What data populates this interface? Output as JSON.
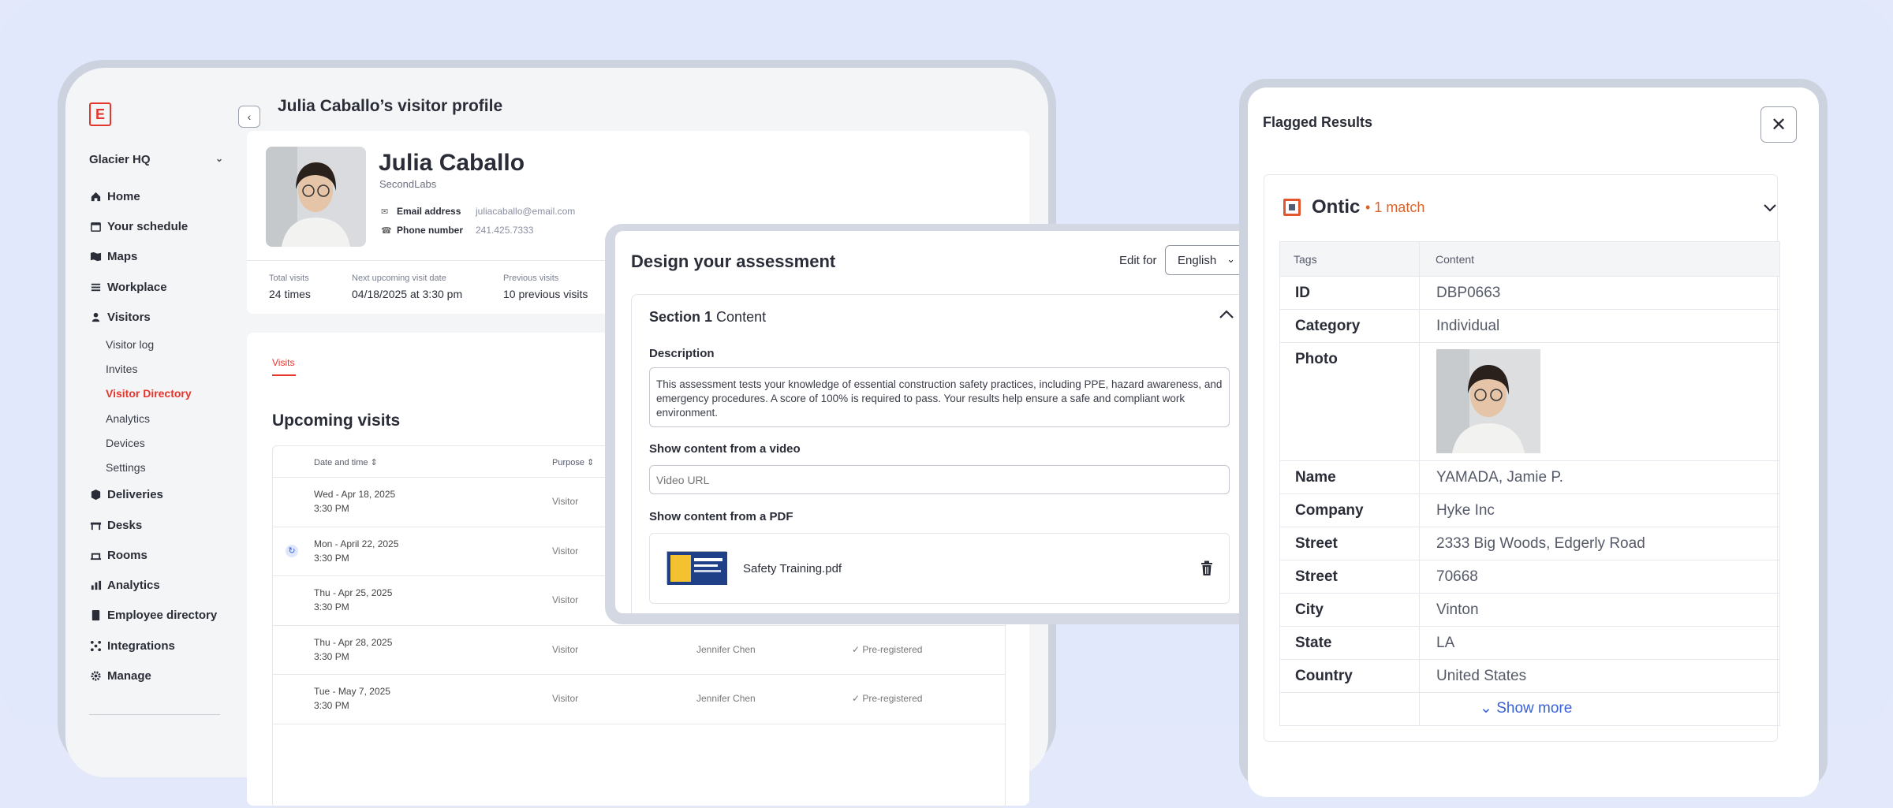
{
  "sidebar": {
    "location": "Glacier HQ",
    "nav_items": [
      {
        "label": "Home",
        "icon": "home-icon"
      },
      {
        "label": "Your schedule",
        "icon": "calendar-icon"
      },
      {
        "label": "Maps",
        "icon": "map-icon"
      },
      {
        "label": "Workplace",
        "icon": "list-icon"
      },
      {
        "label": "Visitors",
        "icon": "person-icon"
      }
    ],
    "visitor_subitems": [
      "Visitor log",
      "Invites",
      "Visitor Directory",
      "Analytics",
      "Devices",
      "Settings"
    ],
    "active_subitem": "Visitor Directory",
    "nav_items_after": [
      {
        "label": "Deliveries",
        "icon": "box-icon"
      },
      {
        "label": "Desks",
        "icon": "desk-icon"
      },
      {
        "label": "Rooms",
        "icon": "rooms-icon"
      },
      {
        "label": "Analytics",
        "icon": "chart-icon"
      },
      {
        "label": "Employee directory",
        "icon": "book-icon"
      },
      {
        "label": "Integrations",
        "icon": "integrations-icon"
      },
      {
        "label": "Manage",
        "icon": "gear-icon"
      }
    ]
  },
  "profile": {
    "page_title": "Julia Caballo’s visitor profile",
    "name": "Julia Caballo",
    "company": "SecondLabs",
    "email_label": "Email address",
    "email": "juliacaballo@email.com",
    "phone_label": "Phone number",
    "phone": "241.425.7333",
    "stats": [
      {
        "label": "Total visits",
        "value": "24 times"
      },
      {
        "label": "Next upcoming visit date",
        "value": "04/18/2025 at 3:30 pm"
      },
      {
        "label": "Previous visits",
        "value": "10 previous visits"
      }
    ]
  },
  "visits": {
    "tab": "Visits",
    "heading": "Upcoming visits",
    "columns": {
      "date": "Date and time",
      "purpose": "Purpose"
    },
    "rows": [
      {
        "date": "Wed - Apr 18, 2025",
        "time": "3:30 PM",
        "purpose": "Visitor",
        "host": "",
        "status": "",
        "sync": false
      },
      {
        "date": "Mon - April 22, 2025",
        "time": "3:30 PM",
        "purpose": "Visitor",
        "host": "",
        "status": "",
        "sync": true
      },
      {
        "date": "Thu - Apr 25, 2025",
        "time": "3:30 PM",
        "purpose": "Visitor",
        "host": "",
        "status": "",
        "sync": false
      },
      {
        "date": "Thu - Apr 28, 2025",
        "time": "3:30 PM",
        "purpose": "Visitor",
        "host": "Jennifer Chen",
        "status": "Pre-registered",
        "sync": false
      },
      {
        "date": "Tue - May 7, 2025",
        "time": "3:30 PM",
        "purpose": "Visitor",
        "host": "Jennifer Chen",
        "status": "Pre-registered",
        "sync": false
      }
    ]
  },
  "assessment": {
    "title": "Design your assessment",
    "edit_for": "Edit for",
    "language": "English",
    "section_number": "Section 1",
    "section_name": "Content",
    "description_label": "Description",
    "description": "This assessment tests your knowledge of essential construction safety practices, including PPE, hazard awareness, and emergency procedures. A score of 100% is required to pass. Your results help ensure a safe and compliant work environment.",
    "video_label": "Show content from a video",
    "video_placeholder": "Video URL",
    "pdf_label": "Show content from a PDF",
    "pdf_file": "Safety Training.pdf"
  },
  "flagged": {
    "title": "Flagged Results",
    "source": "Ontic",
    "match": "• 1 match",
    "col_tags": "Tags",
    "col_content": "Content",
    "rows": [
      {
        "tag": "ID",
        "value": "DBP0663"
      },
      {
        "tag": "Category",
        "value": "Individual"
      },
      {
        "tag": "Photo",
        "value": ""
      },
      {
        "tag": "Name",
        "value": "YAMADA, Jamie P."
      },
      {
        "tag": "Company",
        "value": "Hyke Inc"
      },
      {
        "tag": "Street",
        "value": "2333 Big Woods, Edgerly Road"
      },
      {
        "tag": "Street",
        "value": "70668"
      },
      {
        "tag": "City",
        "value": "Vinton"
      },
      {
        "tag": "State",
        "value": "LA"
      },
      {
        "tag": "Country",
        "value": "United States"
      }
    ],
    "show_more": "Show more"
  },
  "colors": {
    "accent": "#e3362d",
    "link": "#3a62d8",
    "match": "#d9642b"
  }
}
